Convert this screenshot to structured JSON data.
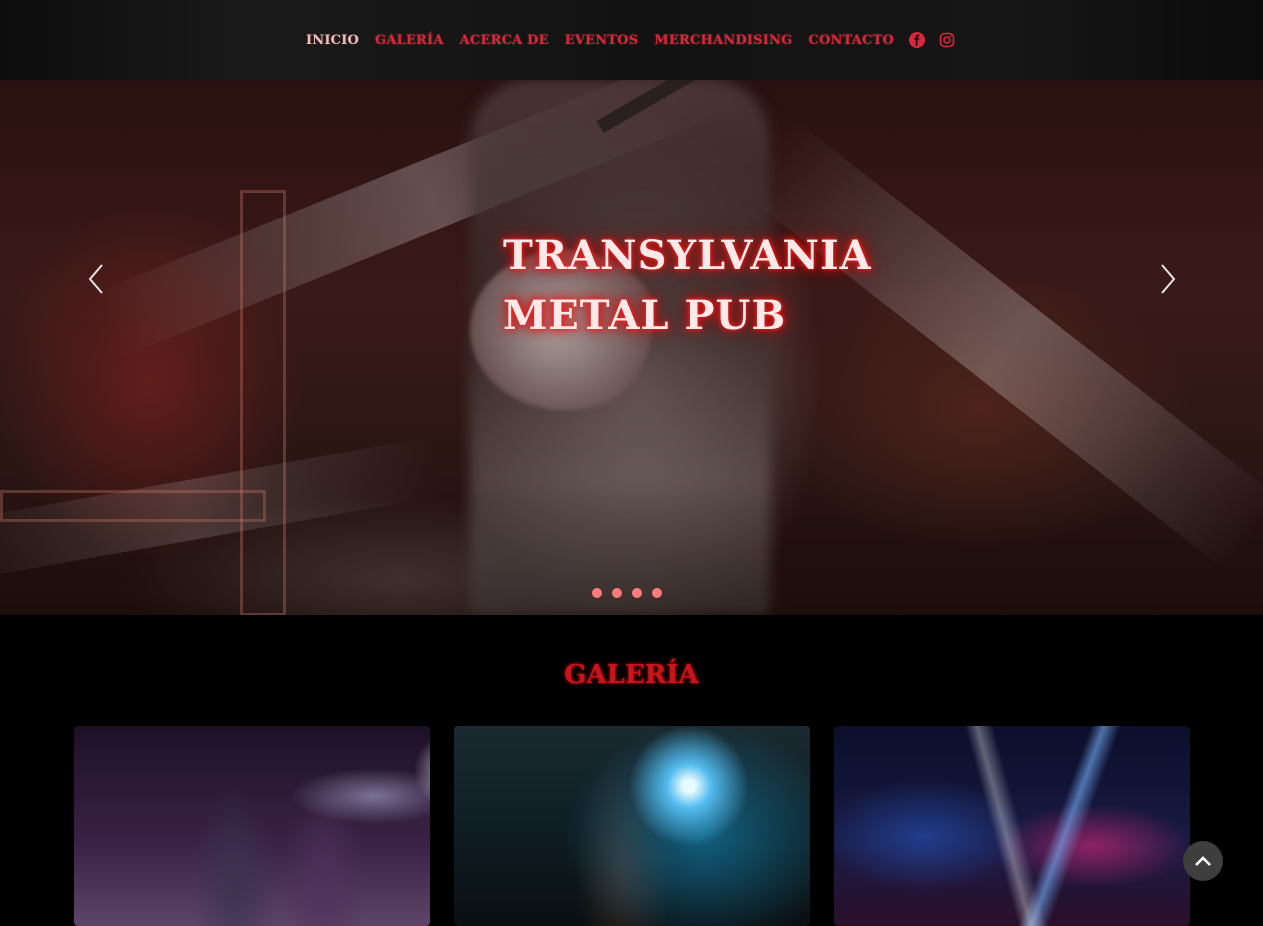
{
  "nav": {
    "items": [
      {
        "label": "INICIO",
        "active": true
      },
      {
        "label": "GALERÍA",
        "active": false
      },
      {
        "label": "ACERCA DE",
        "active": false
      },
      {
        "label": "EVENTOS",
        "active": false
      },
      {
        "label": "MERCHANDISING",
        "active": false
      },
      {
        "label": "CONTACTO",
        "active": false
      }
    ],
    "social": [
      "facebook-icon",
      "instagram-icon"
    ],
    "active_color": "#e8c0c0",
    "link_color": "#d9263a"
  },
  "hero": {
    "title": "TRANSYLVANIA\nMETAL PUB",
    "slide_count": 4,
    "prev_icon": "chevron-left-icon",
    "next_icon": "chevron-right-icon"
  },
  "gallery": {
    "title": "GALERÍA",
    "title_color": "#c8141c",
    "cards": [
      "band-on-stage-photo",
      "singer-guitarist-photo",
      "concert-lights-photo"
    ]
  },
  "scroll_top_icon": "chevron-up-icon"
}
